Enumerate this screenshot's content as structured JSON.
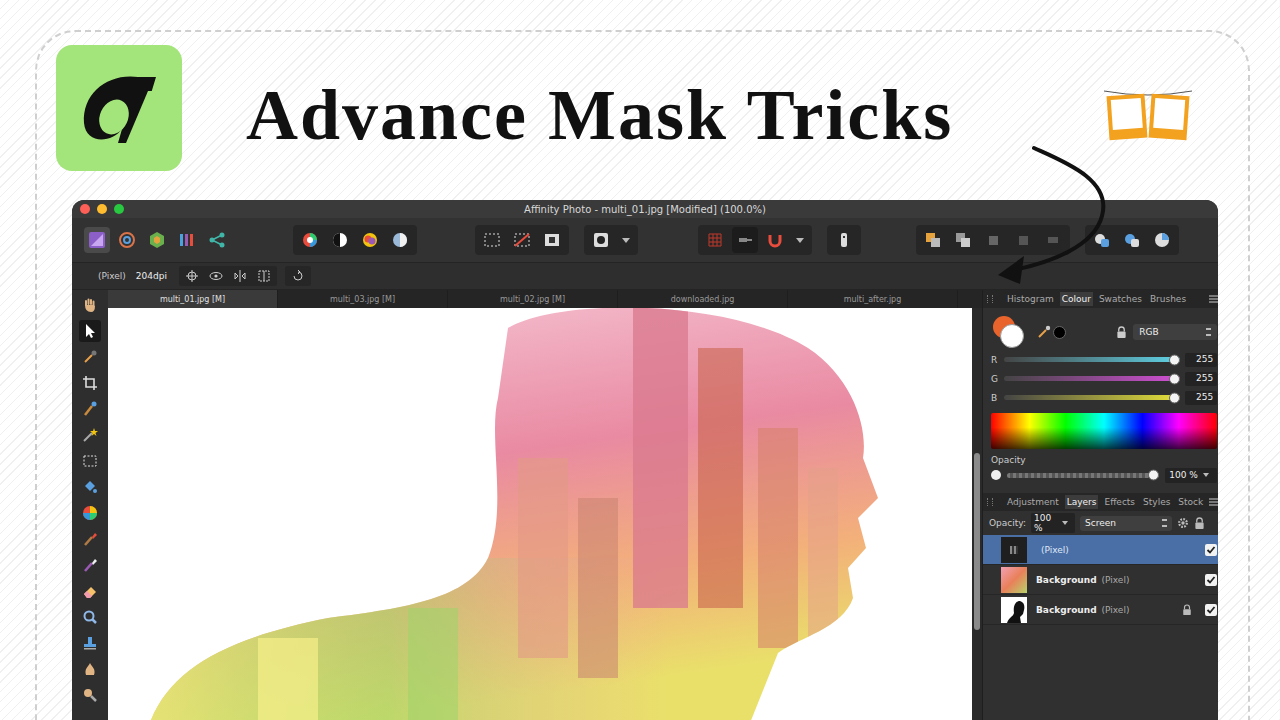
{
  "thumbnail": {
    "headline": "Advance Mask Tricks"
  },
  "window": {
    "title": "Affinity Photo - multi_01.jpg [Modified] (100.0%)"
  },
  "personas": [
    {
      "kind": "photo",
      "selected": true
    },
    {
      "kind": "liquify",
      "selected": false
    },
    {
      "kind": "develop",
      "selected": false
    },
    {
      "kind": "tonemap",
      "selected": false
    },
    {
      "kind": "export",
      "selected": false
    }
  ],
  "context_toolbar": {
    "unit": "(Pixel)",
    "resolution": "204dpi"
  },
  "document_tabs": [
    {
      "label": "multi_01.jpg [M]",
      "selected": true
    },
    {
      "label": "multi_03.jpg [M]",
      "selected": false
    },
    {
      "label": "multi_02.jpg [M]",
      "selected": false
    },
    {
      "label": "downloaded.jpg",
      "selected": false
    },
    {
      "label": "multi_after.jpg",
      "selected": false
    }
  ],
  "tools": [
    {
      "kind": "hand",
      "selected": false
    },
    {
      "kind": "move",
      "selected": true
    },
    {
      "kind": "dropper",
      "selected": false
    },
    {
      "kind": "crop",
      "selected": false
    },
    {
      "kind": "selbrush",
      "selected": false
    },
    {
      "kind": "wand",
      "selected": false
    },
    {
      "kind": "marquee",
      "selected": false
    },
    {
      "kind": "bucket",
      "selected": false
    },
    {
      "kind": "wheel",
      "selected": false
    },
    {
      "kind": "brush",
      "selected": false
    },
    {
      "kind": "brush2",
      "selected": false
    },
    {
      "kind": "eraser",
      "selected": false
    },
    {
      "kind": "lens",
      "selected": false
    },
    {
      "kind": "stamp",
      "selected": false
    },
    {
      "kind": "smudge",
      "selected": false
    },
    {
      "kind": "dodge",
      "selected": false
    }
  ],
  "colour_panel": {
    "tabs": [
      {
        "label": "Histogram",
        "selected": false
      },
      {
        "label": "Colour",
        "selected": true
      },
      {
        "label": "Swatches",
        "selected": false
      },
      {
        "label": "Brushes",
        "selected": false
      }
    ],
    "swatches": [
      {
        "role": "fill",
        "color": "#e8642c"
      },
      {
        "role": "stroke",
        "color": "#ffffff"
      }
    ],
    "model": "RGB",
    "channels": [
      {
        "name": "R",
        "value": "255",
        "level": 1,
        "color": "#5fd3e6"
      },
      {
        "name": "G",
        "value": "255",
        "level": 1,
        "color": "#d24fd6"
      },
      {
        "name": "B",
        "value": "255",
        "level": 1,
        "color": "#e6e23a"
      }
    ],
    "opacity": {
      "label": "Opacity",
      "value": "100 %",
      "level": 1
    }
  },
  "layers_panel": {
    "tabs": [
      {
        "label": "Adjustment",
        "selected": false
      },
      {
        "label": "Layers",
        "selected": true
      },
      {
        "label": "Effects",
        "selected": false
      },
      {
        "label": "Styles",
        "selected": false
      },
      {
        "label": "Stock",
        "selected": false
      }
    ],
    "opacity_label": "Opacity:",
    "opacity_value": "100 %",
    "blend_mode": "Screen",
    "layers": [
      {
        "name": "",
        "type": "(Pixel)",
        "kind": "pixel",
        "selected": true,
        "visible": true,
        "locked": false
      },
      {
        "name": "Background",
        "type": "(Pixel)",
        "kind": "photo",
        "selected": false,
        "visible": true,
        "locked": false
      },
      {
        "name": "Background",
        "type": "(Pixel)",
        "kind": "silhouette",
        "selected": false,
        "visible": true,
        "locked": true
      }
    ]
  }
}
